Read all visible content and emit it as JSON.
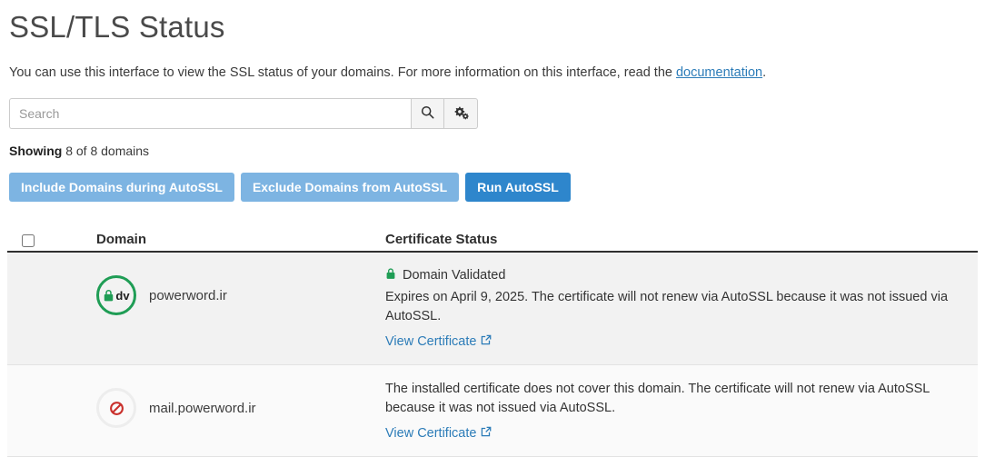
{
  "page": {
    "title": "SSL/TLS Status",
    "description_before": "You can use this interface to view the SSL status of your domains. For more information on this interface, read the ",
    "description_link": "documentation",
    "description_after": "."
  },
  "search": {
    "placeholder": "Search",
    "value": "",
    "search_button_icon": "search-icon",
    "settings_button_icon": "cogs-icon"
  },
  "showing": {
    "label": "Showing",
    "text": " 8 of 8 domains"
  },
  "actions": {
    "include_label": "Include Domains during AutoSSL",
    "exclude_label": "Exclude Domains from AutoSSL",
    "run_label": "Run AutoSSL"
  },
  "colors": {
    "muted_button": "#7db4e2",
    "primary_button": "#2e86cc",
    "link": "#2c7cb8",
    "validated_green": "#1f9d55",
    "blocked_red": "#c9302c"
  },
  "table": {
    "headers": {
      "domain": "Domain",
      "certificate_status": "Certificate Status"
    },
    "rows": [
      {
        "badge": "domain-validated-dv-icon",
        "badge_text": "dv",
        "domain": "powerword.ir",
        "status_title": "Domain Validated",
        "status_title_icon": "lock-icon",
        "status_text": "Expires on April 9, 2025. The certificate will not renew via AutoSSL because it was not issued via AutoSSL.",
        "view_certificate_label": "View Certificate"
      },
      {
        "badge": "no-certificate-ban-icon",
        "badge_text": "",
        "domain": "mail.powerword.ir",
        "status_title": "",
        "status_title_icon": "",
        "status_text": "The installed certificate does not cover this domain. The certificate will not renew via AutoSSL because it was not issued via AutoSSL.",
        "view_certificate_label": "View Certificate"
      }
    ]
  }
}
